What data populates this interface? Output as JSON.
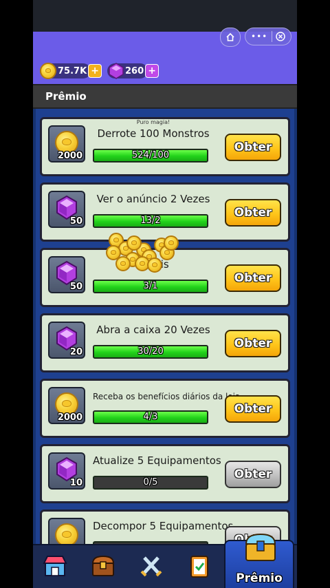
{
  "header": {
    "coins": "75.7K",
    "gems": "260"
  },
  "tab_title": "Prêmio",
  "tasks": [
    {
      "subtitle": "Puro magia!",
      "title": "Derrote 100 Monstros",
      "reward_type": "coin",
      "reward": "2000",
      "progress_text": "524/100",
      "progress_fraction": 1.0,
      "button": "Obter",
      "button_state": "active"
    },
    {
      "subtitle": "",
      "title": "Ver o anúncio 2 Vezes",
      "reward_type": "gem",
      "reward": "50",
      "progress_text": "13/2",
      "progress_fraction": 1.0,
      "button": "Obter",
      "button_state": "active"
    },
    {
      "subtitle": "",
      "title": "Níveis",
      "reward_type": "gem",
      "reward": "50",
      "progress_text": "3/1",
      "progress_fraction": 1.0,
      "button": "Obter",
      "button_state": "active"
    },
    {
      "subtitle": "",
      "title": "Abra a caixa 20 Vezes",
      "reward_type": "gem",
      "reward": "20",
      "progress_text": "30/20",
      "progress_fraction": 1.0,
      "button": "Obter",
      "button_state": "active"
    },
    {
      "subtitle": "",
      "title": "Receba os benefícios diários da loja",
      "reward_type": "coin",
      "reward": "2000",
      "progress_text": "4/3",
      "progress_fraction": 1.0,
      "button": "Obter",
      "button_state": "active"
    },
    {
      "subtitle": "",
      "title": "Atualize 5 Equipamentos",
      "reward_type": "gem",
      "reward": "10",
      "progress_text": "0/5",
      "progress_fraction": 0.0,
      "button": "Obter",
      "button_state": "disabled"
    },
    {
      "subtitle": "",
      "title": "Decompor 5 Equipamentos",
      "reward_type": "coin",
      "reward": "",
      "progress_text": "",
      "progress_fraction": 0.0,
      "button": "Obter",
      "button_state": "disabled"
    }
  ],
  "bottom_nav": {
    "items": [
      "shop-icon",
      "chest-icon",
      "battle-swords-icon",
      "clipboard-quest-icon",
      "reward-chest-icon"
    ],
    "active_label": "Prêmio"
  },
  "colors": {
    "header": "#6b5ce8",
    "list_bg": "#1e4090",
    "card": "#dbe8d4",
    "progress_green": "#22d21a",
    "button_gold": "#ffc51a"
  }
}
